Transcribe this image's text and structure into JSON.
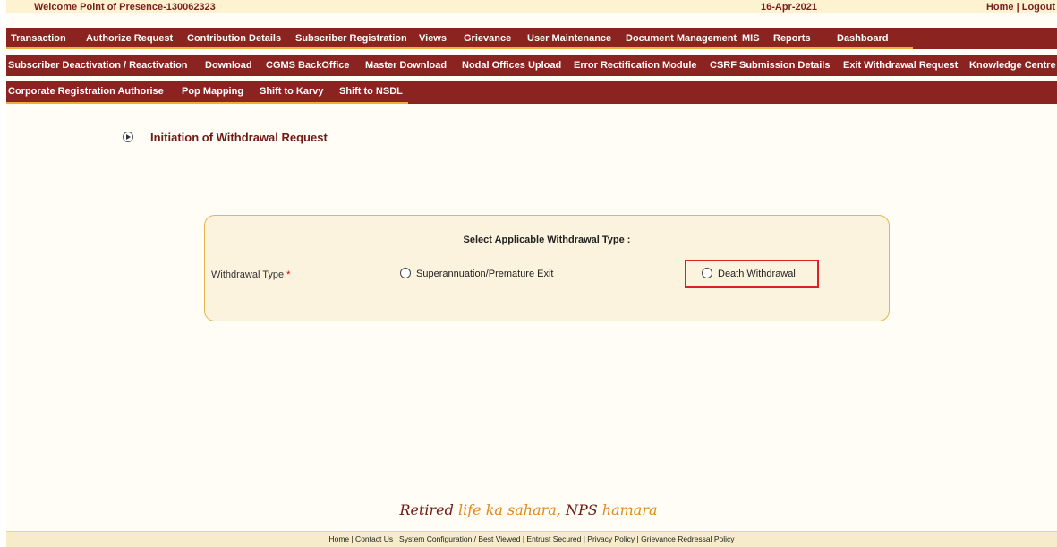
{
  "topbar": {
    "welcome": "Welcome Point of Presence-130062323",
    "date": "16-Apr-2021",
    "home": "Home",
    "sep": "|",
    "logout": "Logout"
  },
  "menu_row1": [
    "Transaction",
    "Authorize Request",
    "Contribution Details",
    "Subscriber Registration",
    "Views",
    "Grievance",
    "User Maintenance",
    "Document Management",
    "MIS",
    "Reports",
    "Dashboard"
  ],
  "menu_row2": [
    "Subscriber Deactivation / Reactivation",
    "Download",
    "CGMS BackOffice",
    "Master Download",
    "Nodal Offices Upload",
    "Error Rectification Module",
    "CSRF Submission Details",
    "Exit Withdrawal Request",
    "Knowledge Centre"
  ],
  "menu_row3": [
    "Corporate Registration Authorise",
    "Pop Mapping",
    "Shift to Karvy",
    "Shift to NSDL"
  ],
  "page": {
    "title": "Initiation of Withdrawal Request"
  },
  "form": {
    "heading": "Select Applicable Withdrawal Type :",
    "label": "Withdrawal Type",
    "required_marker": "*",
    "option1": "Superannuation/Premature Exit",
    "option2": "Death Withdrawal"
  },
  "slogan": {
    "part1": "Retired ",
    "part2": "life ka sahara, ",
    "part3": "NPS ",
    "part4": "hamara"
  },
  "footer": {
    "links": "Home | Contact Us | System Configuration / Best Viewed | Entrust Secured | Privacy Policy | Grievance Redressal Policy"
  },
  "colors": {
    "menu_bg": "#8b2320",
    "accent": "#e8b23a",
    "highlight": "#e02020"
  }
}
